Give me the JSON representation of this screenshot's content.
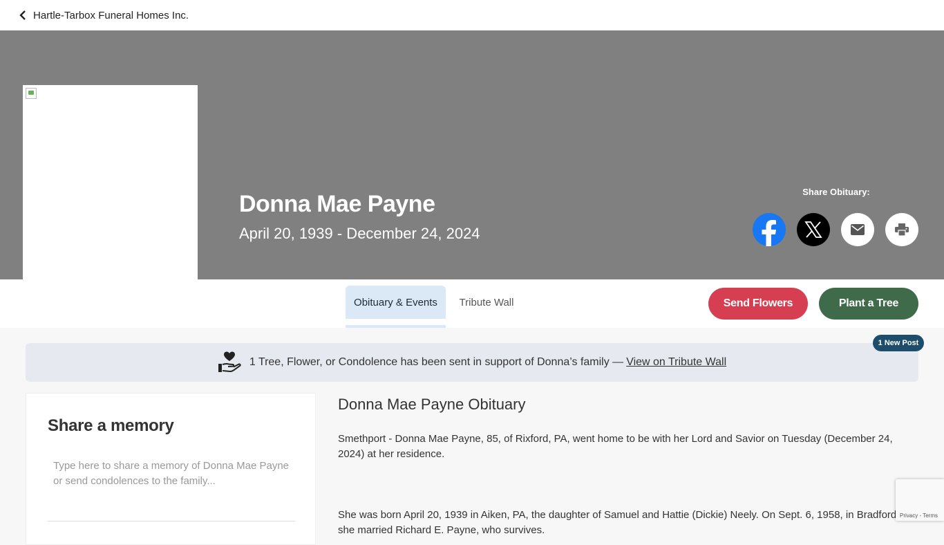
{
  "topbar": {
    "home_link": "Hartle-Tarbox Funeral Homes Inc."
  },
  "hero": {
    "name": "Donna Mae Payne",
    "dates": "April 20, 1939 - December 24, 2024",
    "share_label": "Share Obituary:",
    "share_icons": [
      "facebook-icon",
      "x-icon",
      "mail-icon",
      "print-icon"
    ]
  },
  "tabs": [
    {
      "label": "Obituary & Events",
      "active": true
    },
    {
      "label": "Tribute Wall",
      "active": false
    }
  ],
  "actions": {
    "send_flowers": "Send Flowers",
    "plant_tree": "Plant a Tree"
  },
  "banner": {
    "text": "1 Tree, Flower, or Condolence has been sent in support of Donna’s family —",
    "link": "View on Tribute Wall",
    "badge": "1 New Post"
  },
  "memory": {
    "title": "Share a memory",
    "placeholder": "Type here to share a memory of Donna Mae Payne or send condolences to the family..."
  },
  "obituary": {
    "title": "Donna Mae Payne Obituary",
    "paragraphs": [
      "Smethport - Donna Mae Payne, 85, of Rixford, PA, went home to be with her Lord and Savior on Tuesday (December 24, 2024) at her residence.",
      "She was born April 20, 1939 in Aiken, PA, the daughter of Samuel and Hattie (Dickie) Neely. On Sept. 6, 1958, in Bradford she married Richard E. Payne, who survives."
    ]
  },
  "recaptcha": {
    "privacy": "Privacy",
    "sep": " - ",
    "terms": "Terms"
  },
  "colors": {
    "hero_bg": "#808080",
    "flowers": "#d63f52",
    "tree": "#3f6b4a",
    "facebook": "#1877f2",
    "badge": "#1d4d6b",
    "active_tab": "#dbe9f7"
  }
}
